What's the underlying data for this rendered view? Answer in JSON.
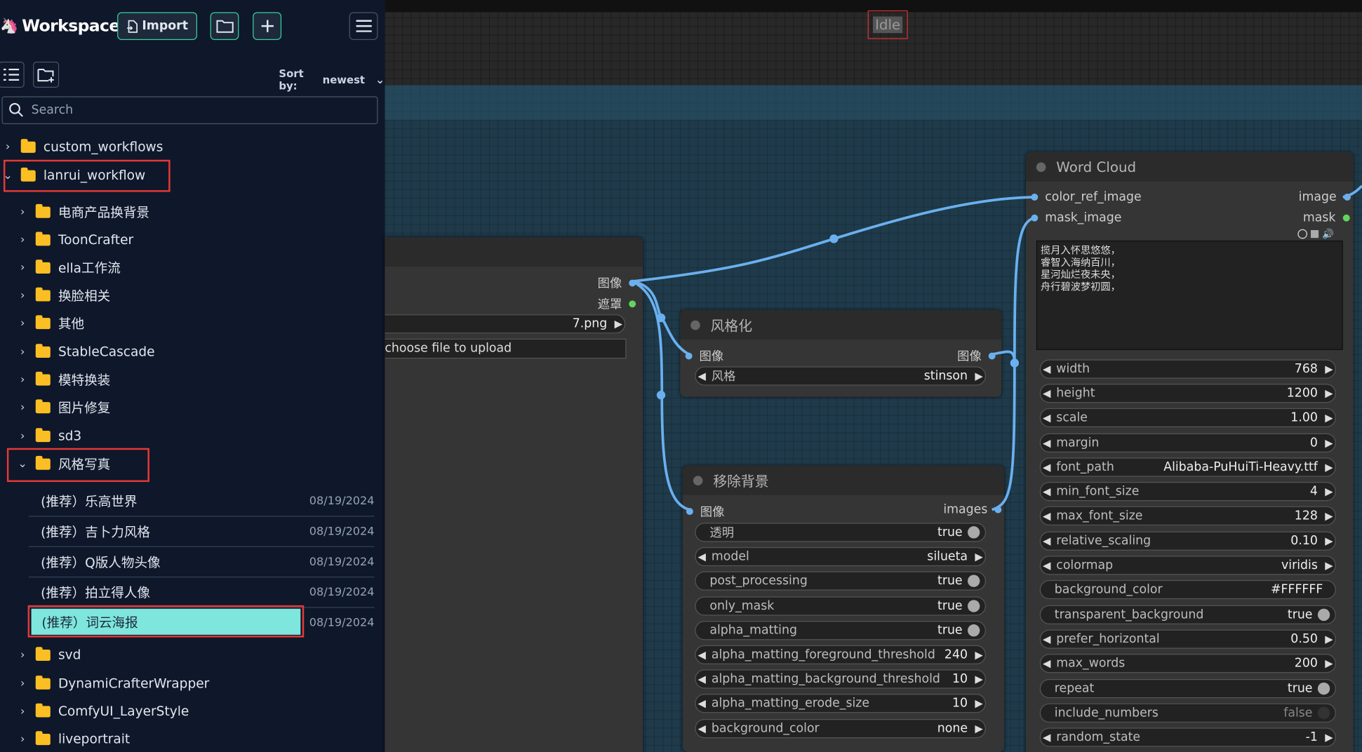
{
  "sidebar": {
    "brand": "Workspace",
    "import_label": "Import",
    "sort_label": "Sort by:",
    "sort_value": "newest",
    "search_placeholder": "Search",
    "tree": [
      {
        "label": "custom_workflows",
        "expanded": false
      },
      {
        "label": "lanrui_workflow",
        "expanded": true
      },
      {
        "label": "电商产品换背景",
        "expanded": false
      },
      {
        "label": "ToonCrafter",
        "expanded": false
      },
      {
        "label": "ella工作流",
        "expanded": false
      },
      {
        "label": "换脸相关",
        "expanded": false
      },
      {
        "label": "其他",
        "expanded": false
      },
      {
        "label": "StableCascade",
        "expanded": false
      },
      {
        "label": "模特换装",
        "expanded": false
      },
      {
        "label": "图片修复",
        "expanded": false
      },
      {
        "label": "sd3",
        "expanded": false
      },
      {
        "label": "风格写真",
        "expanded": true
      }
    ],
    "workflows": [
      {
        "name": "(推荐）乐高世界",
        "date": "08/19/2024"
      },
      {
        "name": "(推荐）吉卜力风格",
        "date": "08/19/2024"
      },
      {
        "name": "(推荐）Q版人物头像",
        "date": "08/19/2024"
      },
      {
        "name": "(推荐）拍立得人像",
        "date": "08/19/2024"
      },
      {
        "name": "(推荐）词云海报",
        "date": "08/19/2024"
      }
    ],
    "tree_after": [
      {
        "label": "svd"
      },
      {
        "label": "DynamiCrafterWrapper"
      },
      {
        "label": "ComfyUI_LayerStyle"
      },
      {
        "label": "liveportrait"
      }
    ]
  },
  "canvas": {
    "status": "Idle",
    "load_image": {
      "out_image": "图像",
      "out_mask": "遮罩",
      "image_value": "7.png",
      "upload_label": "choose file to upload"
    },
    "stylize": {
      "title": "风格化",
      "in_image": "图像",
      "out_image": "图像",
      "style_label": "风格",
      "style_value": "stinson"
    },
    "remove_bg": {
      "title": "移除背景",
      "in_image": "图像",
      "out_images": "images",
      "widgets": [
        {
          "label": "透明",
          "value": "true",
          "kind": "toggle"
        },
        {
          "label": "model",
          "value": "silueta",
          "kind": "combo"
        },
        {
          "label": "post_processing",
          "value": "true",
          "kind": "toggle"
        },
        {
          "label": "only_mask",
          "value": "true",
          "kind": "toggle"
        },
        {
          "label": "alpha_matting",
          "value": "true",
          "kind": "toggle"
        },
        {
          "label": "alpha_matting_foreground_threshold",
          "value": "240",
          "kind": "number"
        },
        {
          "label": "alpha_matting_background_threshold",
          "value": "10",
          "kind": "number"
        },
        {
          "label": "alpha_matting_erode_size",
          "value": "10",
          "kind": "number"
        },
        {
          "label": "background_color",
          "value": "none",
          "kind": "combo"
        }
      ]
    },
    "word_cloud": {
      "title": "Word Cloud",
      "in_color_ref": "color_ref_image",
      "in_mask": "mask_image",
      "out_image": "image",
      "out_mask": "mask",
      "text": "揽月入怀思悠悠，\n睿智入海纳百川，\n星河灿烂夜未央，\n舟行碧波梦初圆，",
      "widgets": [
        {
          "label": "width",
          "value": "768",
          "kind": "number"
        },
        {
          "label": "height",
          "value": "1200",
          "kind": "number"
        },
        {
          "label": "scale",
          "value": "1.00",
          "kind": "number"
        },
        {
          "label": "margin",
          "value": "0",
          "kind": "number"
        },
        {
          "label": "font_path",
          "value": "Alibaba-PuHuiTi-Heavy.ttf",
          "kind": "combo"
        },
        {
          "label": "min_font_size",
          "value": "4",
          "kind": "number"
        },
        {
          "label": "max_font_size",
          "value": "128",
          "kind": "number"
        },
        {
          "label": "relative_scaling",
          "value": "0.10",
          "kind": "number"
        },
        {
          "label": "colormap",
          "value": "viridis",
          "kind": "combo"
        },
        {
          "label": "background_color",
          "value": "#FFFFFF",
          "kind": "text"
        },
        {
          "label": "transparent_background",
          "value": "true",
          "kind": "toggle"
        },
        {
          "label": "prefer_horizontal",
          "value": "0.50",
          "kind": "number"
        },
        {
          "label": "max_words",
          "value": "200",
          "kind": "number"
        },
        {
          "label": "repeat",
          "value": "true",
          "kind": "toggle"
        },
        {
          "label": "include_numbers",
          "value": "false",
          "kind": "toggle_off"
        },
        {
          "label": "random_state",
          "value": "-1",
          "kind": "number"
        }
      ]
    }
  },
  "colors": {
    "accent": "#34d399",
    "selected_row": "#7ee6dc",
    "highlight_box": "#e53935",
    "wire": "#6ab0ef",
    "folder": "#fbbf24"
  }
}
